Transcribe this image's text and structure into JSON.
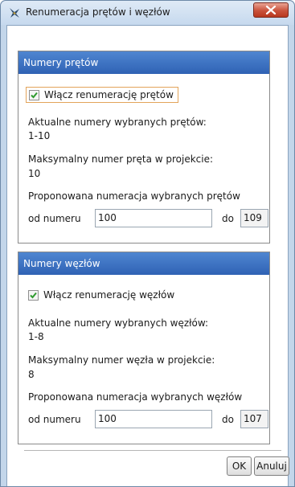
{
  "window": {
    "title": "Renumeracja prętów i węzłów"
  },
  "bars": {
    "header": "Numery prętów",
    "enable_label": "Włącz renumerację prętów",
    "current_label": "Aktualne numery wybranych prętów:",
    "current_value": "1-10",
    "max_label": "Maksymalny numer pręta w projekcie:",
    "max_value": "10",
    "proposed_label": "Proponowana numeracja wybranych prętów",
    "from_label": "od numeru",
    "from_value": "100",
    "to_label": "do",
    "to_value": "109"
  },
  "nodes": {
    "header": "Numery węzłów",
    "enable_label": "Włącz renumerację węzłów",
    "current_label": "Aktualne numery wybranych węzłów:",
    "current_value": "1-8",
    "max_label": "Maksymalny numer węzła w projekcie:",
    "max_value": "8",
    "proposed_label": "Proponowana numeracja wybranych węzłów",
    "from_label": "od numeru",
    "from_value": "100",
    "to_label": "do",
    "to_value": "107"
  },
  "buttons": {
    "ok": "OK",
    "cancel": "Anuluj"
  },
  "colors": {
    "panel_header": "#3a6fc0",
    "checkmark": "#2e9a2e",
    "close_button": "#c9523b"
  }
}
